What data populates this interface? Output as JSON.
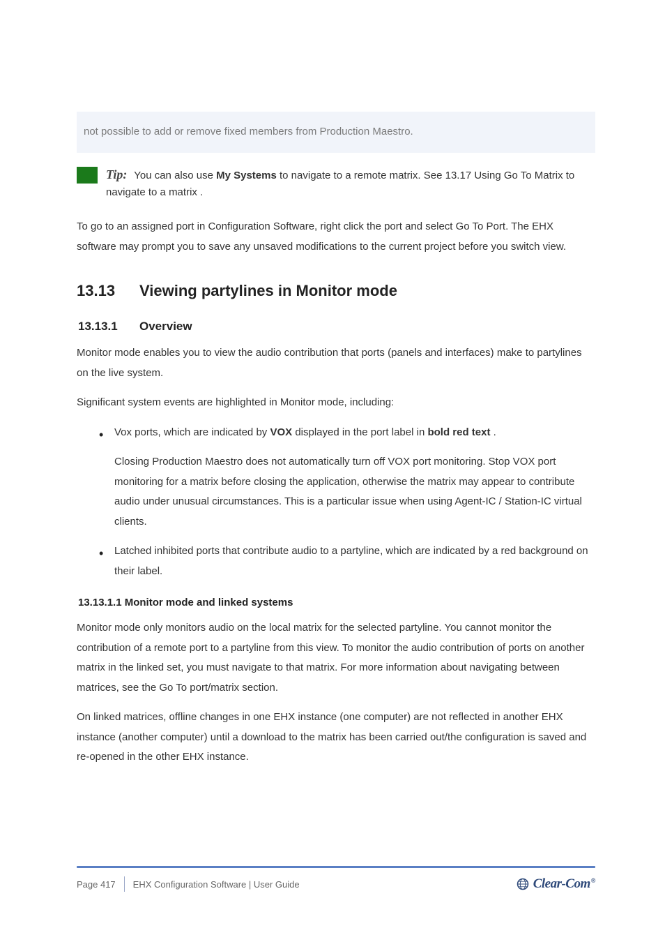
{
  "callout": {
    "text": "not possible to add or remove fixed members from Production Maestro."
  },
  "tip": {
    "label": "Tip:",
    "body": "You can also use ",
    "bold": "My Systems",
    "after_bold": " to navigate to a remote matrix. See ",
    "link": "13.17 Using Go To Matrix to navigate to a matrix",
    "after_link": "."
  },
  "intro_para": "To go to an assigned port in Configuration Software, right click the port and select Go To Port. The EHX software may prompt you to save any unsaved modifications to the current project before you switch view.",
  "sections": {
    "s1": {
      "num": "13.13",
      "title": "Viewing partylines in Monitor mode"
    },
    "s2": {
      "num": "13.13.1",
      "title": "Overview"
    }
  },
  "para1": "Monitor mode enables you to view the audio contribution that ports (panels and interfaces) make to partylines on the live system.",
  "para2": "Significant system events are highlighted in Monitor mode, including:",
  "bullets": {
    "b1_intro": "Vox ports, which are indicated by ",
    "b1_bold1": "VOX",
    "b1_mid": " displayed in the port label in ",
    "b1_bold2": "bold red text",
    "b1_after": ".",
    "b1_line2": "Closing Production Maestro does not automatically turn off VOX port monitoring. Stop VOX port monitoring for a matrix before closing the application, otherwise the matrix may appear to contribute audio under unusual circumstances. This is a particular issue when using Agent-IC / Station-IC virtual clients.",
    "b2": "Latched inhibited ports that contribute audio to a partyline, which are indicated by a red background on their label."
  },
  "h4_1": "13.13.1.1    Monitor mode and linked systems",
  "para3": "Monitor mode only monitors audio on the local matrix for the selected partyline. You cannot monitor the contribution of a remote port to a partyline from this view. To monitor the audio contribution of ports on another matrix in the linked set, you must navigate to that matrix. For more information about navigating between matrices, see the Go To port/matrix section.",
  "para4": "On linked matrices, offline changes in one EHX instance (one computer) are not reflected in another EHX instance (another computer) until a download to the matrix has been carried out/the configuration is saved and re-opened in the other EHX instance.",
  "footer": {
    "page": "Page 417",
    "doc": "EHX Configuration Software | User Guide",
    "brand": "Clear-Com"
  }
}
